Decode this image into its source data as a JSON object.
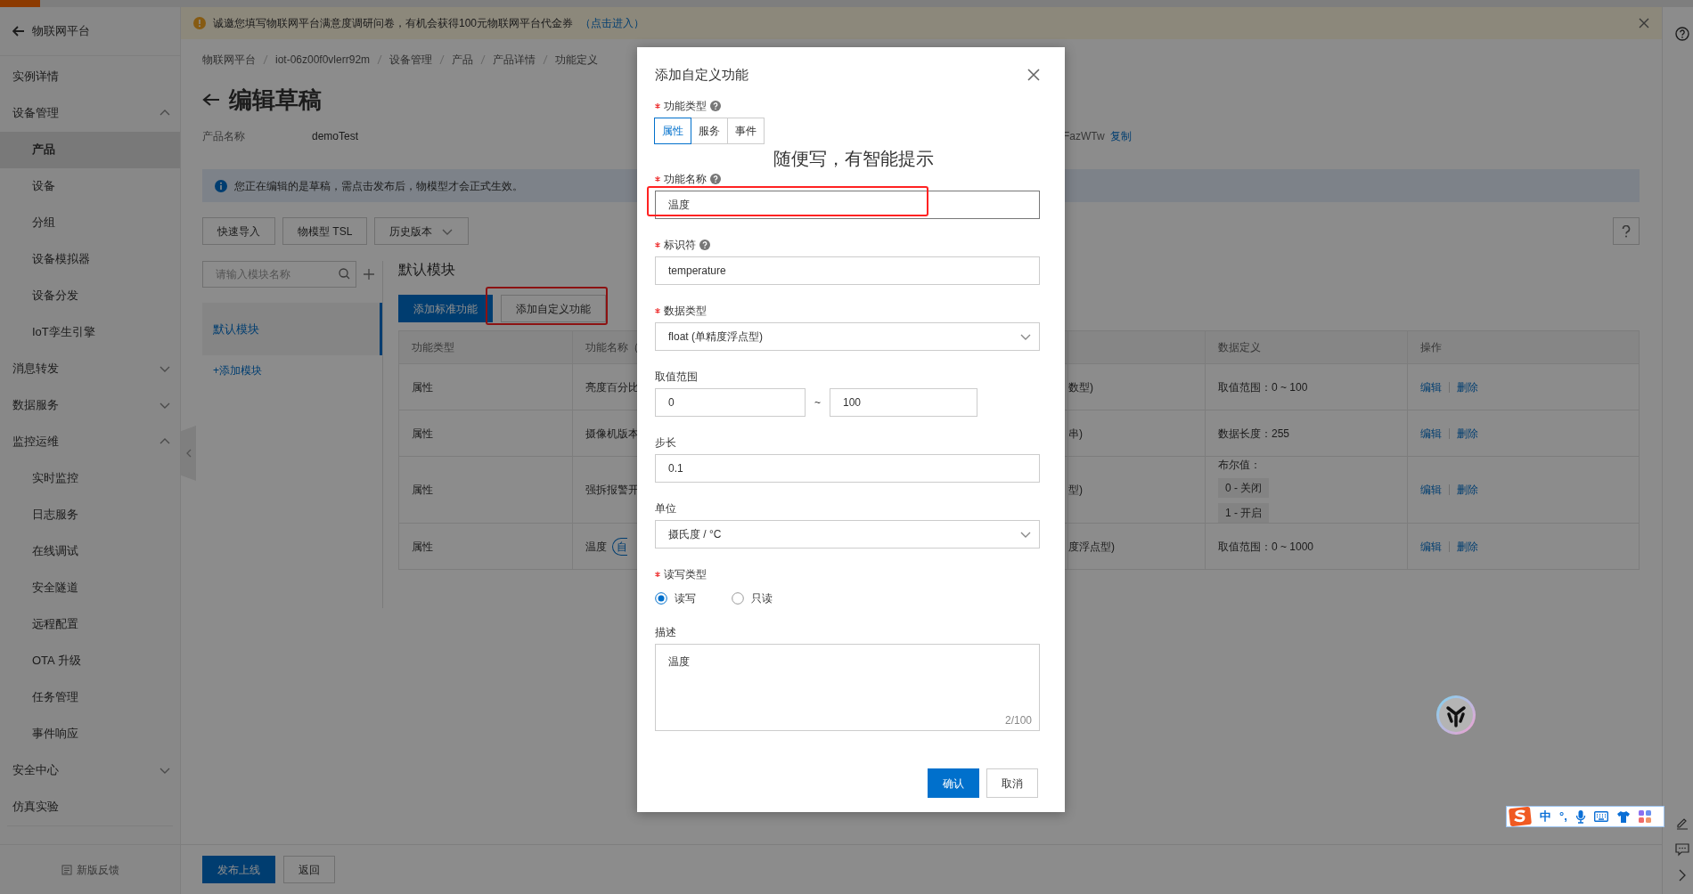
{
  "notice": {
    "text": "诚邀您填写物联网平台满意度调研问卷，有机会获得100元物联网平台代金券",
    "link": "（点击进入）"
  },
  "sidebar": {
    "back_label": "物联网平台",
    "items": [
      {
        "label": "实例详情",
        "selected": false
      },
      {
        "label": "设备管理",
        "selected": false,
        "expanded": true,
        "children": [
          {
            "label": "产品",
            "selected": true
          },
          {
            "label": "设备",
            "selected": false
          },
          {
            "label": "分组",
            "selected": false
          },
          {
            "label": "设备模拟器",
            "selected": false
          },
          {
            "label": "设备分发",
            "selected": false
          },
          {
            "label": "IoT孪生引擎",
            "selected": false
          }
        ]
      },
      {
        "label": "消息转发",
        "selected": false,
        "expanded": false
      },
      {
        "label": "数据服务",
        "selected": false,
        "expanded": false
      },
      {
        "label": "监控运维",
        "selected": false,
        "expanded": true,
        "children": [
          {
            "label": "实时监控",
            "selected": false
          },
          {
            "label": "日志服务",
            "selected": false
          },
          {
            "label": "在线调试",
            "selected": false
          },
          {
            "label": "安全隧道",
            "selected": false
          },
          {
            "label": "远程配置",
            "selected": false
          },
          {
            "label": "OTA 升级",
            "selected": false
          },
          {
            "label": "任务管理",
            "selected": false
          },
          {
            "label": "事件响应",
            "selected": false
          }
        ]
      },
      {
        "label": "安全中心",
        "selected": false,
        "expanded": false
      },
      {
        "label": "仿真实验",
        "selected": false
      }
    ],
    "feedback": "新版反馈"
  },
  "breadcrumb": [
    "物联网平台",
    "iot-06z00f0vlerr92m",
    "设备管理",
    "产品",
    "产品详情",
    "功能定义"
  ],
  "page_title": "编辑草稿",
  "product": {
    "label": "产品名称",
    "value": "demoTest",
    "key_fragment": "FazWTw",
    "copy_link": "复制"
  },
  "alert": "您正在编辑的是草稿，需点击发布后，物模型才会正式生效。",
  "toolbar": [
    {
      "label": "快速导入",
      "kind": "button"
    },
    {
      "label": "物模型 TSL",
      "kind": "button"
    },
    {
      "label": "历史版本",
      "kind": "dropdown"
    }
  ],
  "module_search": {
    "placeholder": "请输入模块名称"
  },
  "modules": [
    {
      "label": "默认模块",
      "selected": true
    }
  ],
  "add_module": "+添加模块",
  "module_title": "默认模块",
  "actions": [
    {
      "label": "添加标准功能",
      "kind": "primary",
      "highlighted": false
    },
    {
      "label": "添加自定义功能",
      "kind": "secondary",
      "highlighted": true
    }
  ],
  "table": {
    "columns": [
      "功能类型",
      "功能名称（",
      "",
      "数据定义",
      "操作"
    ],
    "rows": [
      {
        "type": "属性",
        "name": "亮度百分比",
        "data_type": "数型)",
        "definition": "取值范围：0 ~ 100",
        "actions": [
          "编辑",
          "删除"
        ]
      },
      {
        "type": "属性",
        "name": "摄像机版本",
        "data_type": "串)",
        "definition": "数据长度：255",
        "actions": [
          "编辑",
          "删除"
        ]
      },
      {
        "type": "属性",
        "name": "强拆报警开",
        "data_type": "型)",
        "definition": "布尔值：",
        "values": [
          "0 - 关闭",
          "1 - 开启"
        ],
        "actions": [
          "编辑",
          "删除"
        ]
      },
      {
        "type": "属性",
        "name": "温度",
        "tag": "自",
        "data_type": "度浮点型)",
        "definition": "取值范围：0 ~ 1000",
        "actions": [
          "编辑",
          "删除"
        ]
      }
    ]
  },
  "footer_buttons": [
    {
      "label": "发布上线",
      "kind": "primary"
    },
    {
      "label": "返回",
      "kind": "secondary"
    }
  ],
  "modal": {
    "title": "添加自定义功能",
    "annotation": "随便写，有智能提示",
    "fields": [
      {
        "kind": "segmented",
        "label": "功能类型",
        "required": true,
        "help": true,
        "options": [
          {
            "label": "属性",
            "selected": true
          },
          {
            "label": "服务",
            "selected": false
          },
          {
            "label": "事件",
            "selected": false
          }
        ]
      },
      {
        "kind": "text",
        "label": "功能名称",
        "required": true,
        "help": true,
        "value": "温度",
        "highlighted": true
      },
      {
        "kind": "text",
        "label": "标识符",
        "required": true,
        "help": true,
        "value": "temperature",
        "highlighted": false
      },
      {
        "kind": "select",
        "label": "数据类型",
        "required": true,
        "help": false,
        "value": "float (单精度浮点型)"
      },
      {
        "kind": "range",
        "label": "取值范围",
        "required": false,
        "help": false,
        "from": "0",
        "separator": "~",
        "to": "100"
      },
      {
        "kind": "text",
        "label": "步长",
        "required": false,
        "help": false,
        "value": "0.1",
        "highlighted": false
      },
      {
        "kind": "select",
        "label": "单位",
        "required": false,
        "help": false,
        "value": "摄氏度 / °C"
      },
      {
        "kind": "radio",
        "label": "读写类型",
        "required": true,
        "help": false,
        "options": [
          {
            "label": "读写",
            "selected": true
          },
          {
            "label": "只读",
            "selected": false
          }
        ]
      },
      {
        "kind": "textarea",
        "label": "描述",
        "required": false,
        "help": false,
        "value": "温度",
        "counter": "2/100"
      }
    ],
    "buttons": [
      {
        "label": "确认",
        "kind": "primary"
      },
      {
        "label": "取消",
        "kind": "secondary"
      }
    ]
  },
  "ime": {
    "mode": "中",
    "punctuation": "°,"
  }
}
